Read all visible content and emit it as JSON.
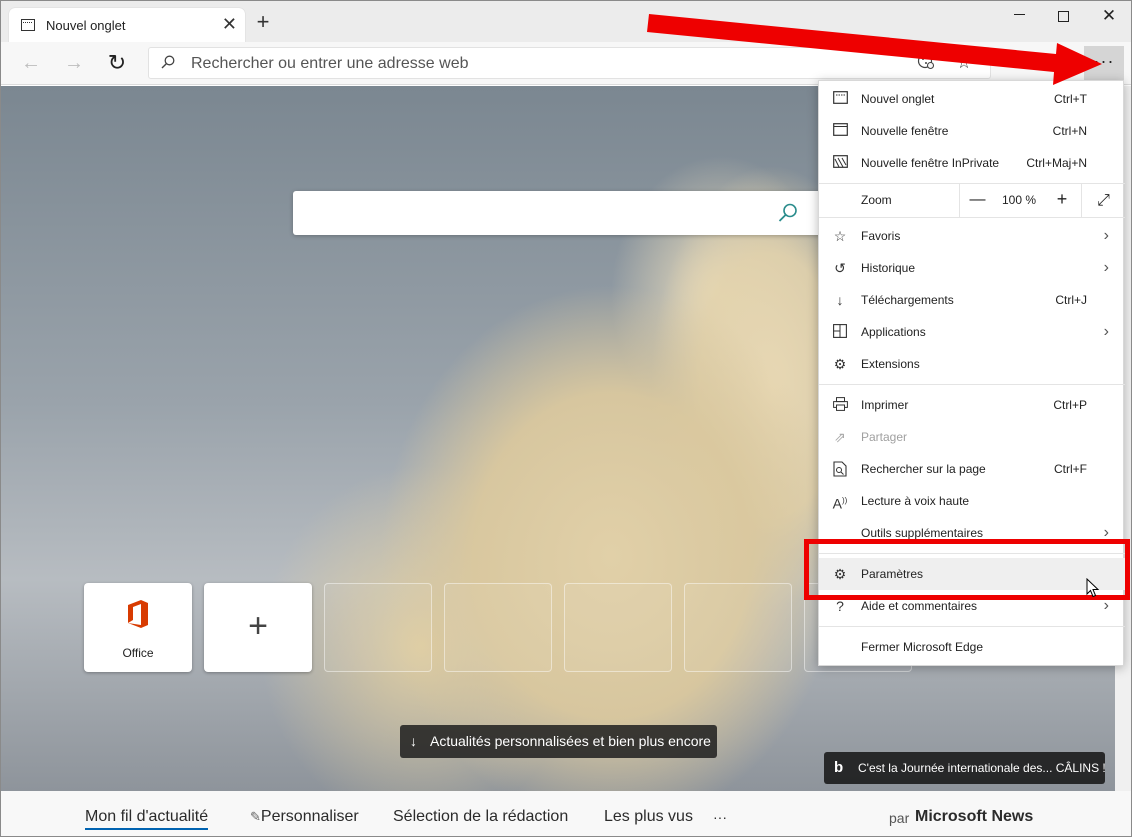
{
  "tab": {
    "title": "Nouvel onglet"
  },
  "address_bar": {
    "placeholder": "Rechercher ou entrer une adresse web"
  },
  "toolbar": {
    "more_label": "···"
  },
  "tiles": [
    {
      "label": "Office"
    }
  ],
  "news_button": {
    "label": "Actualités personnalisées et bien plus encore"
  },
  "bing_banner": {
    "logo": "b",
    "text": "C'est la Journée internationale des... CÂLINS !"
  },
  "news_bar": {
    "items": [
      "Mon fil d'actualité",
      "Personnaliser",
      "Sélection de la rédaction",
      "Les plus vus"
    ],
    "more": "···",
    "by": "par",
    "brand": "Microsoft News"
  },
  "menu": {
    "new_tab": {
      "label": "Nouvel onglet",
      "shortcut": "Ctrl+T"
    },
    "new_window": {
      "label": "Nouvelle fenêtre",
      "shortcut": "Ctrl+N"
    },
    "new_private": {
      "label": "Nouvelle fenêtre InPrivate",
      "shortcut": "Ctrl+Maj+N"
    },
    "zoom": {
      "label": "Zoom",
      "value": "100 %",
      "minus": "—",
      "plus": "+"
    },
    "favorites": {
      "label": "Favoris"
    },
    "history": {
      "label": "Historique"
    },
    "downloads": {
      "label": "Téléchargements",
      "shortcut": "Ctrl+J"
    },
    "apps": {
      "label": "Applications"
    },
    "extensions": {
      "label": "Extensions"
    },
    "print": {
      "label": "Imprimer",
      "shortcut": "Ctrl+P"
    },
    "share": {
      "label": "Partager"
    },
    "find": {
      "label": "Rechercher sur la page",
      "shortcut": "Ctrl+F"
    },
    "read_aloud": {
      "label": "Lecture à voix haute"
    },
    "more_tools": {
      "label": "Outils supplémentaires"
    },
    "settings": {
      "label": "Paramètres"
    },
    "help": {
      "label": "Aide et commentaires"
    },
    "close": {
      "label": "Fermer Microsoft Edge"
    }
  },
  "colors": {
    "annotation": "#ee0000",
    "office": "#d83b01",
    "accent": "#0063b1"
  }
}
